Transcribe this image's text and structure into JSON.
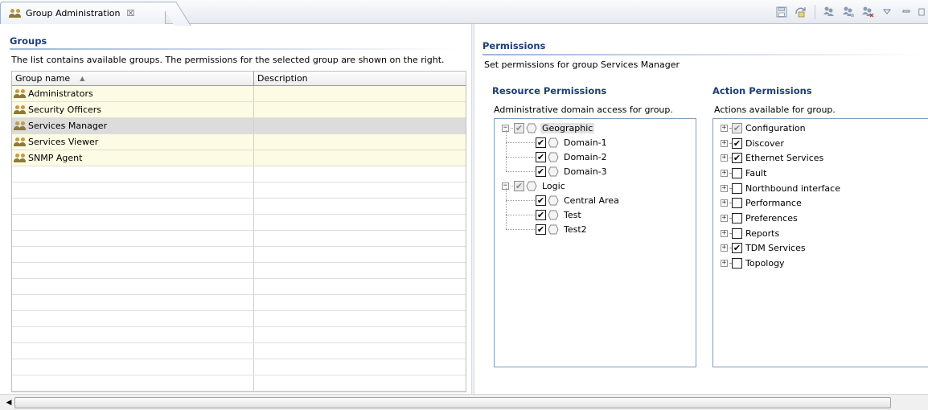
{
  "tab": {
    "title": "Group Administration",
    "close": "☒"
  },
  "toolbar": {
    "icons": [
      "save-icon",
      "refresh-icon",
      "add-group-icon",
      "edit-group-icon",
      "delete-group-icon",
      "view-menu-icon",
      "minimize-icon",
      "maximize-icon"
    ]
  },
  "groups": {
    "title": "Groups",
    "description": "The list contains available groups. The permissions for the selected group are shown on the right.",
    "columns": {
      "name": "Group name",
      "description": "Description"
    },
    "rows": [
      {
        "name": "Administrators",
        "description": ""
      },
      {
        "name": "Security Officers",
        "description": ""
      },
      {
        "name": "Services Manager",
        "description": ""
      },
      {
        "name": "Services Viewer",
        "description": ""
      },
      {
        "name": "SNMP Agent",
        "description": ""
      }
    ],
    "selected": "Services Manager"
  },
  "permissions": {
    "title": "Permissions",
    "description": "Set permissions for group Services Manager",
    "resource": {
      "title": "Resource Permissions",
      "description": "Administrative domain access for group.",
      "nodes": [
        {
          "label": "Geographic",
          "checked": "partial",
          "children": [
            {
              "label": "Domain-1",
              "checked": "yes"
            },
            {
              "label": "Domain-2",
              "checked": "yes"
            },
            {
              "label": "Domain-3",
              "checked": "yes"
            }
          ]
        },
        {
          "label": "Logic",
          "checked": "partial",
          "children": [
            {
              "label": "Central Area",
              "checked": "yes"
            },
            {
              "label": "Test",
              "checked": "yes"
            },
            {
              "label": "Test2",
              "checked": "yes"
            }
          ]
        }
      ]
    },
    "action": {
      "title": "Action Permissions",
      "description": "Actions available for group.",
      "items": [
        {
          "label": "Configuration",
          "checked": "partial"
        },
        {
          "label": "Discover",
          "checked": "yes"
        },
        {
          "label": "Ethernet Services",
          "checked": "yes"
        },
        {
          "label": "Fault",
          "checked": "no"
        },
        {
          "label": "Northbound interface",
          "checked": "no"
        },
        {
          "label": "Performance",
          "checked": "no"
        },
        {
          "label": "Preferences",
          "checked": "no"
        },
        {
          "label": "Reports",
          "checked": "no"
        },
        {
          "label": "TDM Services",
          "checked": "yes"
        },
        {
          "label": "Topology",
          "checked": "no"
        }
      ]
    }
  },
  "colors": {
    "header": "#1f3d74",
    "row_fill": "#fdfbe3",
    "row_selected": "#dcdcdc"
  }
}
